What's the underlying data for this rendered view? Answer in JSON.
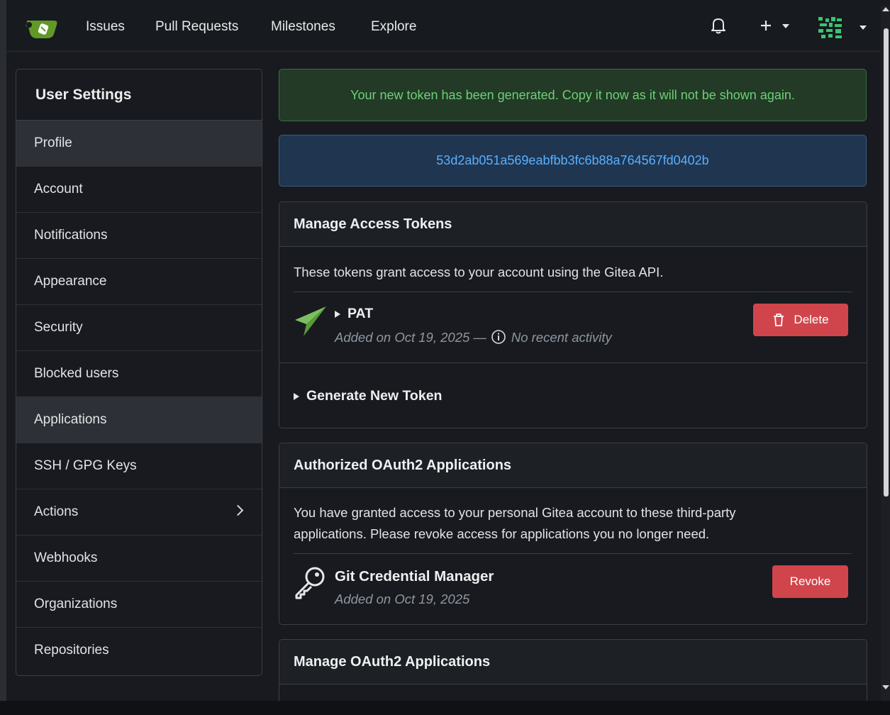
{
  "nav": {
    "links": [
      "Issues",
      "Pull Requests",
      "Milestones",
      "Explore"
    ]
  },
  "sidebar": {
    "title": "User Settings",
    "items": [
      {
        "label": "Profile"
      },
      {
        "label": "Account"
      },
      {
        "label": "Notifications"
      },
      {
        "label": "Appearance"
      },
      {
        "label": "Security"
      },
      {
        "label": "Blocked users"
      },
      {
        "label": "Applications"
      },
      {
        "label": "SSH / GPG Keys"
      },
      {
        "label": "Actions"
      },
      {
        "label": "Webhooks"
      },
      {
        "label": "Organizations"
      },
      {
        "label": "Repositories"
      }
    ]
  },
  "alerts": {
    "success": "Your new token has been generated. Copy it now as it will not be shown again.",
    "token": "53d2ab051a569eabfbb3fc6b88a764567fd0402b"
  },
  "tokens_panel": {
    "title": "Manage Access Tokens",
    "description": "These tokens grant access to your account using the Gitea API.",
    "token_name": "PAT",
    "token_added": "Added on Oct 19, 2025 —",
    "token_activity": "No recent activity",
    "delete_label": "Delete",
    "generate_label": "Generate New Token"
  },
  "oauth_panel": {
    "title": "Authorized OAuth2 Applications",
    "description_line1": "You have granted access to your personal Gitea account to these third-party",
    "description_line2": "applications. Please revoke access for applications you no longer need.",
    "app_name": "Git Credential Manager",
    "app_added": "Added on Oct 19, 2025",
    "revoke_label": "Revoke"
  },
  "manage_oauth_panel": {
    "title": "Manage OAuth2 Applications"
  },
  "colors": {
    "success_text": "#6fcf76",
    "info_text": "#5ab0ff",
    "danger": "#d0454b",
    "gitea_green": "#609926"
  }
}
